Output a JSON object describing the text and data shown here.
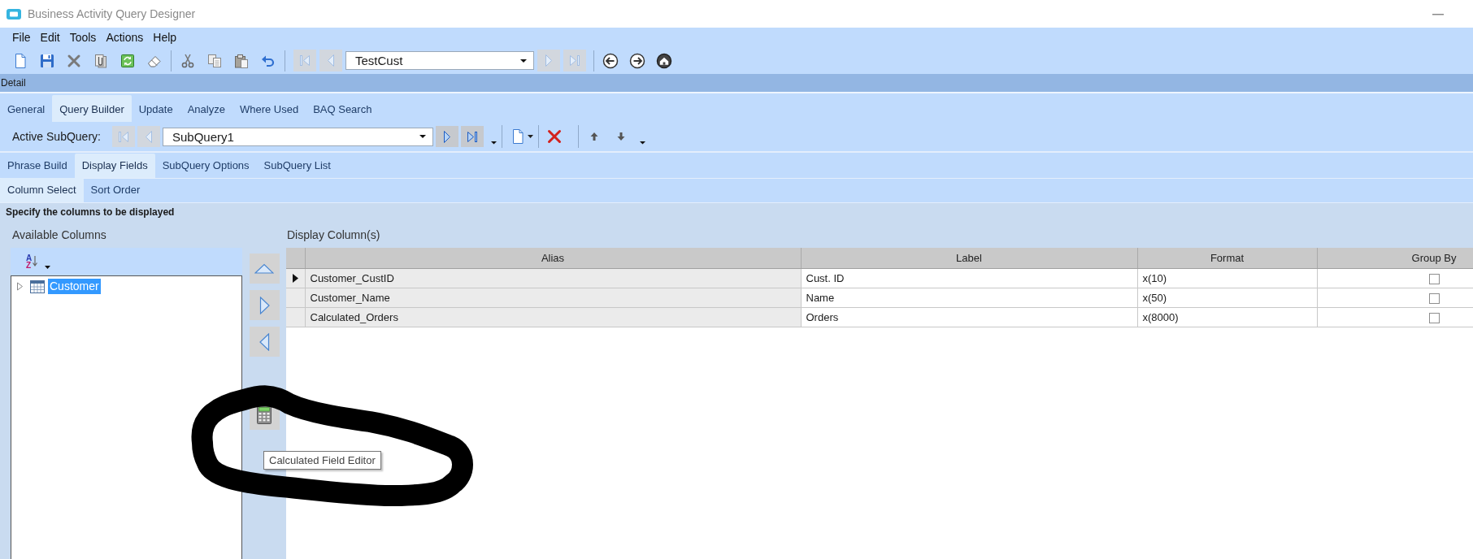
{
  "window": {
    "title": "Business Activity Query Designer"
  },
  "menu": [
    "File",
    "Edit",
    "Tools",
    "Actions",
    "Help"
  ],
  "toolbar": {
    "nav_before": [
      {
        "kind": "first",
        "disabled": true
      },
      {
        "kind": "prev",
        "disabled": true
      }
    ],
    "record": "TestCust",
    "nav_after": [
      {
        "kind": "next",
        "disabled": true
      },
      {
        "kind": "last",
        "disabled": true
      }
    ]
  },
  "section": "Detail",
  "tabs": [
    {
      "label": "General",
      "selected": false
    },
    {
      "label": "Query Builder",
      "selected": true
    },
    {
      "label": "Update",
      "selected": false
    },
    {
      "label": "Analyze",
      "selected": false
    },
    {
      "label": "Where Used",
      "selected": false
    },
    {
      "label": "BAQ Search",
      "selected": false
    }
  ],
  "subquery_bar": {
    "label": "Active SubQuery:",
    "nav_before": [
      {
        "kind": "first",
        "disabled": true
      },
      {
        "kind": "prev",
        "disabled": true
      }
    ],
    "subquery": "SubQuery1",
    "nav_after": [
      {
        "kind": "next",
        "disabled": false
      },
      {
        "kind": "last",
        "disabled": false
      }
    ]
  },
  "subtabs": [
    {
      "label": "Phrase Build",
      "selected": false
    },
    {
      "label": "Display Fields",
      "selected": true
    },
    {
      "label": "SubQuery Options",
      "selected": false
    },
    {
      "label": "SubQuery List",
      "selected": false
    }
  ],
  "column_tabs": [
    {
      "label": "Column Select",
      "selected": true
    },
    {
      "label": "Sort Order",
      "selected": false
    }
  ],
  "instruction": "Specify the columns to be displayed",
  "available_columns": {
    "title": "Available Columns",
    "sort_icon": [
      "A",
      "Z"
    ],
    "tree": [
      {
        "label": "Customer",
        "selected": true,
        "expanded": false
      }
    ]
  },
  "display_columns": {
    "title": "Display Column(s)",
    "columns": [
      "Alias",
      "Label",
      "Format",
      "Group By"
    ],
    "rows": [
      {
        "current": true,
        "alias": "Customer_CustID",
        "label": "Cust. ID",
        "format": "x(10)",
        "group_by": false
      },
      {
        "current": false,
        "alias": "Customer_Name",
        "label": "Name",
        "format": "x(50)",
        "group_by": false
      },
      {
        "current": false,
        "alias": "Calculated_Orders",
        "label": "Orders",
        "format": "x(8000)",
        "group_by": false
      }
    ]
  },
  "tooltip": "Calculated Field Editor"
}
